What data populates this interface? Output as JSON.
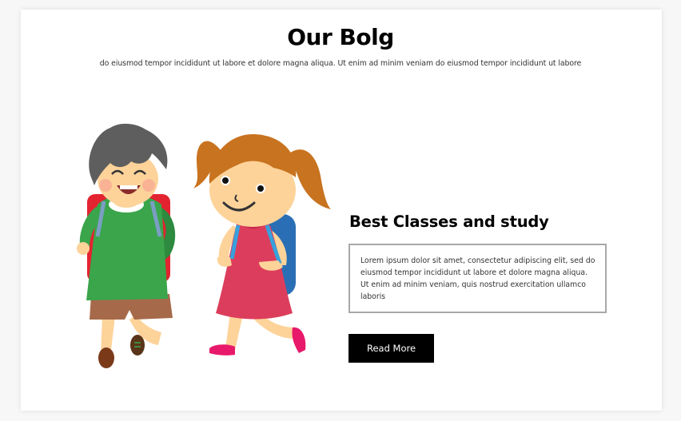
{
  "section": {
    "title": "Our Bolg",
    "subtitle": "do eiusmod tempor incididunt ut labore et dolore magna aliqua. Ut enim ad minim veniam do eiusmod tempor incididunt ut labore"
  },
  "post": {
    "heading": "Best Classes and study",
    "excerpt": "Lorem ipsum dolor sit amet, consectetur adipiscing elit, sed do eiusmod tempor incididunt ut labore et dolore magna aliqua. Ut enim ad minim veniam, quis nostrud exercitation ullamco laboris",
    "button_label": "Read More"
  },
  "illustration": {
    "icon": "kids-with-backpacks-illustration",
    "colors": {
      "boy_shirt": "#3aa54b",
      "boy_shorts": "#a66a4a",
      "boy_backpack": "#e32330",
      "girl_dress": "#dd3d5c",
      "girl_hair": "#c8731f",
      "girl_backpack": "#2a6fb5",
      "girl_shoes": "#e8196a",
      "skin": "#fdd39a"
    }
  },
  "theme": {
    "button_bg": "#000000",
    "button_text": "#ffffff",
    "border": "#a8a8a8"
  }
}
